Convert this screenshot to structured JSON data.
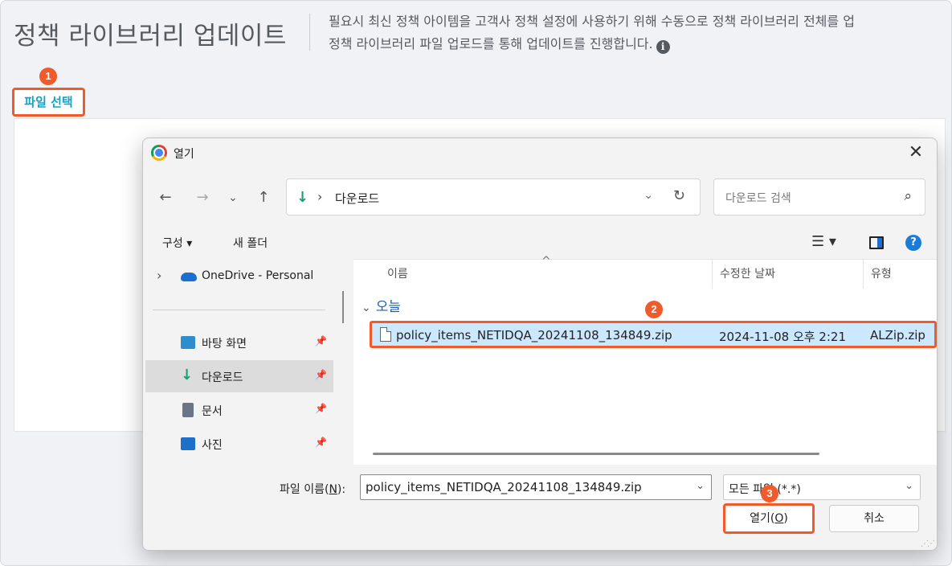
{
  "page": {
    "title": "정책 라이브러리 업데이트",
    "description_line1": "필요시 최신 정책 아이템을 고객사 정책 설정에 사용하기 위해 수동으로 정책 라이브러리 전체를 업",
    "description_line2": "정책 라이브러리 파일 업로드를 통해 업데이트를 진행합니다.",
    "info_icon_glyph": "i",
    "file_select_label": "파일 선택"
  },
  "badges": [
    "1",
    "2",
    "3"
  ],
  "dialog": {
    "title": "열기",
    "close_glyph": "✕",
    "nav": {
      "back": "←",
      "forward": "→",
      "recent": "⌄",
      "up": "↑"
    },
    "address": {
      "icon_glyph": "↓",
      "separator": "›",
      "location": "다운로드",
      "chevron": "⌄",
      "refresh": "↻"
    },
    "search_placeholder": "다운로드 검색",
    "search_glyph": "⌕",
    "toolbar": {
      "organize": "구성 ▾",
      "new_folder": "새 폴더",
      "view_glyph": "☰ ▾",
      "help_glyph": "?"
    },
    "nav_pane": [
      {
        "label": "OneDrive - Personal",
        "chevron": "›",
        "icon": "onedrive-cloud-icon",
        "pinned": false,
        "selected": false
      },
      {
        "label": "바탕 화면",
        "icon": "desktop-icon",
        "pinned": true,
        "selected": false
      },
      {
        "label": "다운로드",
        "icon": "download-icon",
        "pinned": true,
        "selected": true
      },
      {
        "label": "문서",
        "icon": "document-icon",
        "pinned": true,
        "selected": false
      },
      {
        "label": "사진",
        "icon": "pictures-icon",
        "pinned": true,
        "selected": false
      }
    ],
    "pin_glyph": "📌",
    "columns": [
      "이름",
      "수정한 날짜",
      "유형"
    ],
    "group_label": "오늘",
    "files": [
      {
        "name": "policy_items_NETIDQA_20241108_134849.zip",
        "modified": "2024-11-08 오후 2:21",
        "type": "ALZip.zip"
      }
    ],
    "filename_label_prefix": "파일 이름(",
    "filename_label_key": "N",
    "filename_label_suffix": "):",
    "filename_value": "policy_items_NETIDQA_20241108_134849.zip",
    "filetype_value": "모든 파일 (*.*)",
    "open_label_prefix": "열기(",
    "open_label_key": "O",
    "open_label_suffix": ")",
    "cancel_label": "취소"
  },
  "colors": {
    "accent": "#f15a2b",
    "link": "#13a2c6",
    "selection": "#cce8ff"
  }
}
